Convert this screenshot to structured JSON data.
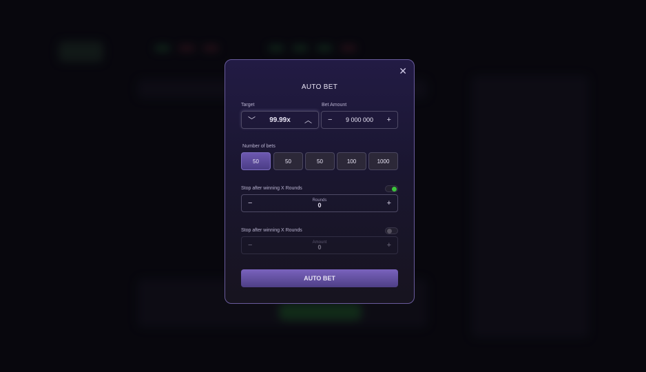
{
  "modal": {
    "title": "AUTO BET",
    "close_icon": "close-icon",
    "target": {
      "label": "Target",
      "value": "99.99x"
    },
    "bet_amount": {
      "label": "Bet Amount",
      "value": "9 000 000"
    },
    "number_of_bets": {
      "label": "Number of bets",
      "options": [
        "50",
        "50",
        "50",
        "100",
        "1000"
      ],
      "selected_index": 0
    },
    "stop_win": {
      "label": "Stop after winning X Rounds",
      "enabled": true,
      "field_label": "Rounds",
      "value": "0",
      "toggle_color": "#3cc43c"
    },
    "stop_loss": {
      "label": "Stop after winning X Rounds",
      "enabled": false,
      "field_label": "Amount",
      "value": "0"
    },
    "submit_label": "AUTO BET"
  },
  "colors": {
    "accent": "#6d58b0",
    "border": "#6a5c9e"
  }
}
